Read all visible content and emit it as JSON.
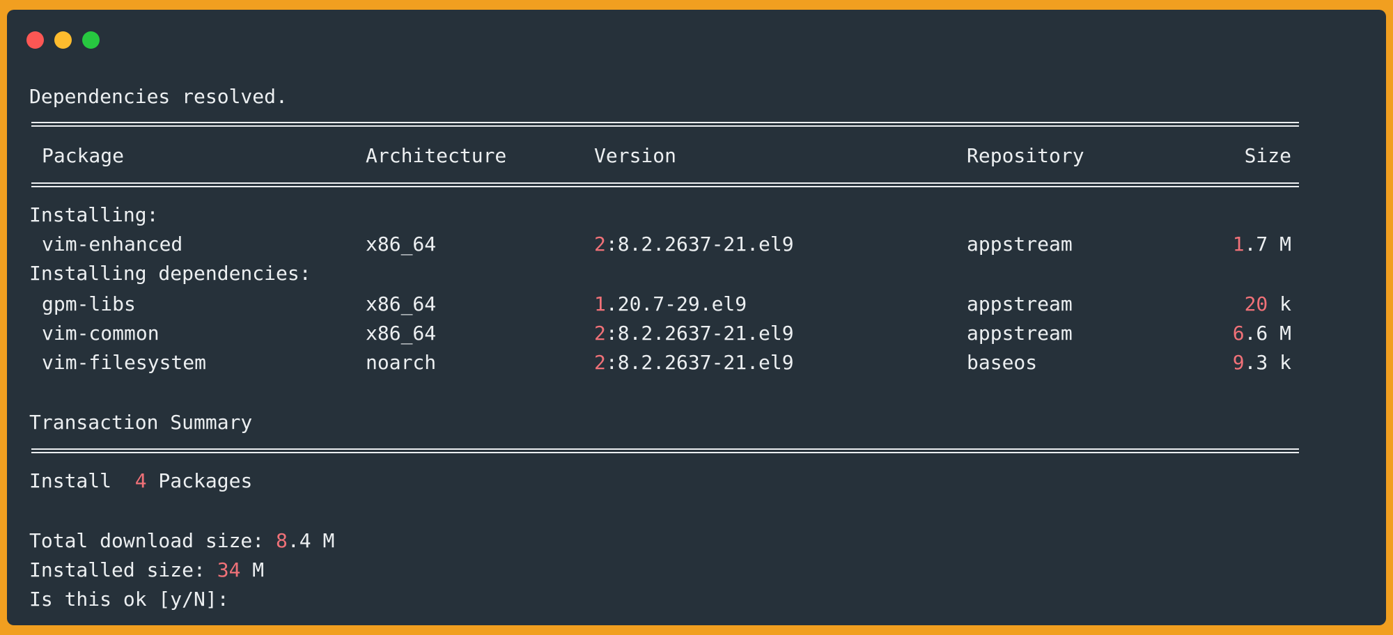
{
  "window": {
    "controls": [
      "close",
      "minimize",
      "maximize"
    ],
    "colors": {
      "close": "#fd5754",
      "minimize": "#febc2e",
      "maximize": "#27c840"
    }
  },
  "accent_color": "#f07178",
  "terminal": {
    "status": "Dependencies resolved.",
    "headers": {
      "package": "Package",
      "arch": "Architecture",
      "version": "Version",
      "repo": "Repository",
      "size": "Size"
    },
    "installing_label": "Installing:",
    "dependencies_label": "Installing dependencies:",
    "packages": [
      {
        "name": "vim-enhanced",
        "arch": "x86_64",
        "version_num": "2",
        "version_rest": ":8.2.2637-21.el9",
        "repo": "appstream",
        "size_num": "1",
        "size_rest": ".7 M"
      },
      {
        "name": "gpm-libs",
        "arch": "x86_64",
        "version_num": "1",
        "version_rest": ".20.7-29.el9",
        "repo": "appstream",
        "size_num": "20",
        "size_rest": " k"
      },
      {
        "name": "vim-common",
        "arch": "x86_64",
        "version_num": "2",
        "version_rest": ":8.2.2637-21.el9",
        "repo": "appstream",
        "size_num": "6",
        "size_rest": ".6 M"
      },
      {
        "name": "vim-filesystem",
        "arch": "noarch",
        "version_num": "2",
        "version_rest": ":8.2.2637-21.el9",
        "repo": "baseos",
        "size_num": "9",
        "size_rest": ".3 k"
      }
    ],
    "summary_title": "Transaction Summary",
    "install_line": {
      "prefix": "Install  ",
      "num": "4",
      "suffix": " Packages"
    },
    "download_line": {
      "prefix": "Total download size: ",
      "num": "8",
      "suffix": ".4 M"
    },
    "installed_line": {
      "prefix": "Installed size: ",
      "num": "34",
      "suffix": " M"
    },
    "prompt": "Is this ok [y/N]: "
  }
}
